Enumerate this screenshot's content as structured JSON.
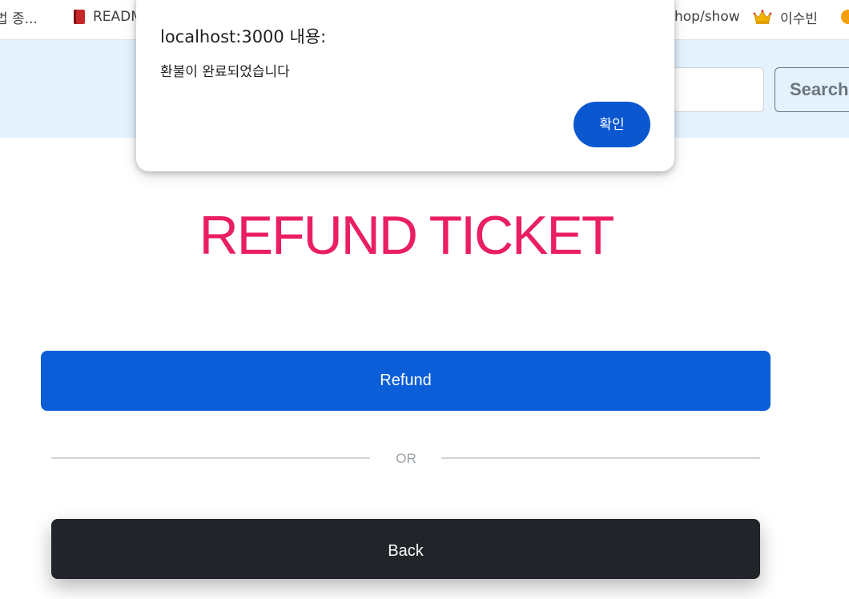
{
  "bookmarks": [
    {
      "label": "법 종...",
      "icon": "page-icon"
    },
    {
      "label": "READM",
      "icon": "book-icon"
    },
    {
      "label": "hop/show",
      "icon": "page-icon"
    },
    {
      "label": "이수빈",
      "icon": "crown-icon"
    },
    {
      "label": "",
      "icon": "orange-circle-icon"
    }
  ],
  "navbar": {
    "search_placeholder": "",
    "search_button_label": "Search"
  },
  "page": {
    "title": "REFUND TICKET",
    "refund_button_label": "Refund",
    "divider_label": "OR",
    "back_button_label": "Back"
  },
  "dialog": {
    "title": "localhost:3000 내용:",
    "message": "환불이 완료되었습니다",
    "ok_label": "확인"
  },
  "colors": {
    "accent_blue": "#0b5ed7",
    "title_pink": "#e91e63",
    "navbar_bg": "#e3f2fd",
    "back_button_bg": "#212529"
  }
}
